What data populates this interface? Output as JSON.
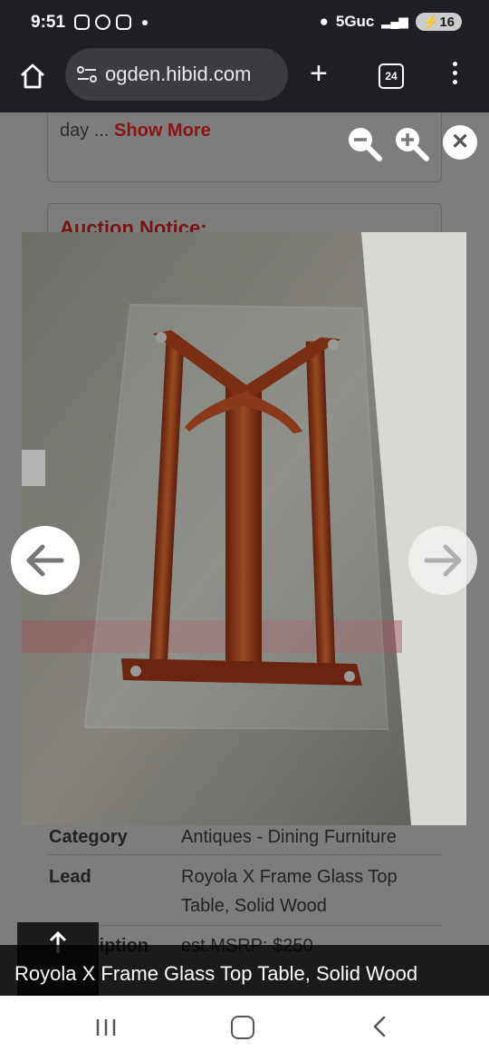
{
  "status": {
    "time": "9:51",
    "network": "5Guc",
    "battery": "16"
  },
  "browser": {
    "url": "ogden.hibid.com",
    "tab_count": "24"
  },
  "page": {
    "description_tail": "day ...",
    "show_more": "Show More",
    "auction_notice": "Auction Notice:",
    "details": [
      {
        "label": "Category",
        "value": "Antiques - Dining Furniture"
      },
      {
        "label": "Lead",
        "value": "Royola X Frame Glass Top Table, Solid Wood"
      },
      {
        "label": "Description",
        "value": "est.MSRP: $250"
      }
    ]
  },
  "viewer": {
    "caption": "Royola X Frame Glass Top Table, Solid Wood",
    "image_alt": "Wooden X-frame table base with rectangular glass top photographed from above on concrete floor"
  },
  "icons": {
    "zoom_out": "zoom-out-icon",
    "zoom_in": "zoom-in-icon",
    "close": "close-icon",
    "prev": "arrow-left-icon",
    "next": "arrow-right-icon"
  },
  "colors": {
    "accent": "#8a1414",
    "statusbar": "#1d1f24",
    "overlay": "#7d7d7d"
  }
}
